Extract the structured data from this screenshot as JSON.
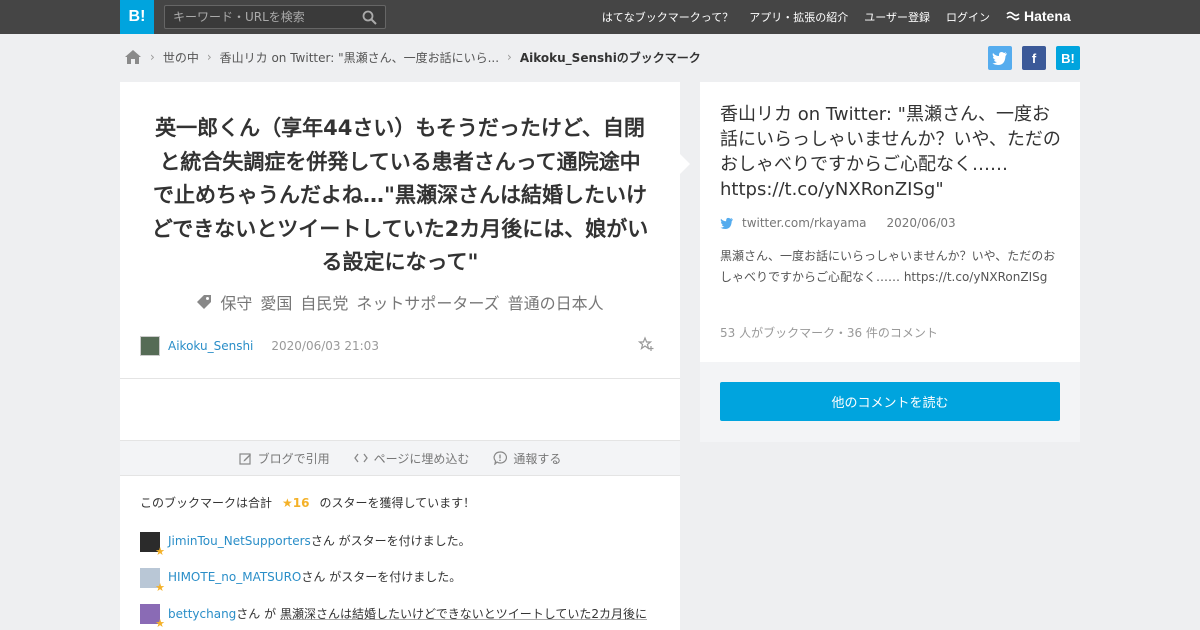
{
  "header": {
    "logo": "B!",
    "search_placeholder": "キーワード・URLを検索",
    "nav": [
      "はてなブックマークって？",
      "アプリ・拡張の紹介",
      "ユーザー登録",
      "ログイン"
    ],
    "brand": "Hatena"
  },
  "breadcrumb": {
    "items": [
      "世の中",
      "香山リカ on Twitter: \"黒瀬さん、一度お話にいら..."
    ],
    "current": "Aikoku_Senshiのブックマーク"
  },
  "share": {
    "twitter": "t",
    "facebook": "f",
    "hatena": "B!"
  },
  "bookmark": {
    "comment": "英一郎くん（享年44さい）もそうだったけど、自閉と統合失調症を併発している患者さんって通院途中で止めちゃうんだよね…\"黒瀬深さんは結婚したいけどできないとツイートしていた2カ月後には、娘がいる設定になって\"",
    "tags": [
      "保守",
      "愛国",
      "自民党",
      "ネットサポーターズ",
      "普通の日本人"
    ],
    "user": "Aikoku_Senshi",
    "date": "2020/06/03 21:03"
  },
  "actions": [
    "ブログで引用",
    "ページに埋め込む",
    "通報する"
  ],
  "stars": {
    "prefix": "このブックマークは合計",
    "count": "16",
    "suffix": "のスターを獲得しています！",
    "entries": [
      {
        "user": "JiminTou_NetSupporters",
        "text": "さん がスターを付けました。"
      },
      {
        "user": "HIMOTE_no_MATSURO",
        "text": "さん がスターを付けました。"
      },
      {
        "user": "bettychang",
        "text": "さん が",
        "quote": "黒瀬深さんは結婚したいけどできないとツイートしていた2カ月後に"
      }
    ]
  },
  "entry": {
    "title": "香山リカ on Twitter: \"黒瀬さん、一度お話にいらっしゃいませんか？いや、ただのおしゃべりですからご心配なく…… https://t.co/yNXRonZISg\"",
    "domain": "twitter.com/rkayama",
    "date": "2020/06/03",
    "description": "黒瀬さん、一度お話にいらっしゃいませんか？いや、ただのおしゃべりですからご心配なく…… https://t.co/yNXRonZISg",
    "counts": "53 人がブックマーク・36 件のコメント",
    "more_button": "他のコメントを読む"
  }
}
